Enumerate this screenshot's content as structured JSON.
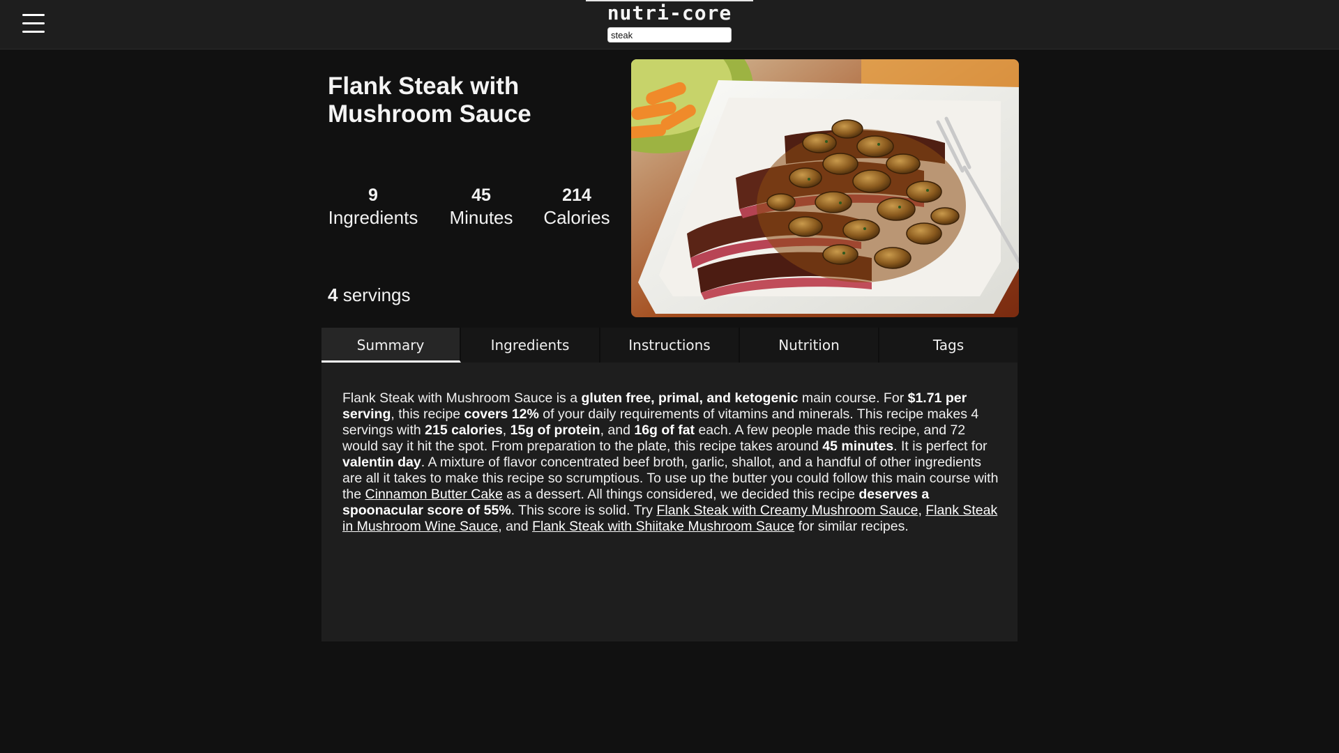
{
  "header": {
    "logo": "nutri-core",
    "search": {
      "value": "steak",
      "placeholder": ""
    }
  },
  "recipe": {
    "title": "Flank Steak with Mushroom Sauce",
    "stats": [
      {
        "value": "9",
        "label": "Ingredients"
      },
      {
        "value": "45",
        "label": "Minutes"
      },
      {
        "value": "214",
        "label": "Calories"
      }
    ],
    "servings": {
      "count": "4",
      "label": "servings"
    },
    "image_alt": "Flank Steak with Mushroom Sauce"
  },
  "tabs": [
    {
      "label": "Summary",
      "active": true
    },
    {
      "label": "Ingredients",
      "active": false
    },
    {
      "label": "Instructions",
      "active": false
    },
    {
      "label": "Nutrition",
      "active": false
    },
    {
      "label": "Tags",
      "active": false
    }
  ],
  "summary": {
    "parts": [
      {
        "t": "text",
        "v": "Flank Steak with Mushroom Sauce is a "
      },
      {
        "t": "bold",
        "v": "gluten free, primal, and ketogenic"
      },
      {
        "t": "text",
        "v": " main course. For "
      },
      {
        "t": "bold",
        "v": "$1.71 per serving"
      },
      {
        "t": "text",
        "v": ", this recipe "
      },
      {
        "t": "bold",
        "v": "covers 12%"
      },
      {
        "t": "text",
        "v": " of your daily requirements of vitamins and minerals. This recipe makes 4 servings with "
      },
      {
        "t": "bold",
        "v": "215 calories"
      },
      {
        "t": "text",
        "v": ", "
      },
      {
        "t": "bold",
        "v": "15g of protein"
      },
      {
        "t": "text",
        "v": ", and "
      },
      {
        "t": "bold",
        "v": "16g of fat"
      },
      {
        "t": "text",
        "v": " each. A few people made this recipe, and 72 would say it hit the spot. From preparation to the plate, this recipe takes around "
      },
      {
        "t": "bold",
        "v": "45 minutes"
      },
      {
        "t": "text",
        "v": ". It is perfect for "
      },
      {
        "t": "bold",
        "v": "valentin day"
      },
      {
        "t": "text",
        "v": ". A mixture of flavor concentrated beef broth, garlic, shallot, and a handful of other ingredients are all it takes to make this recipe so scrumptious. To use up the butter you could follow this main course with the "
      },
      {
        "t": "link",
        "v": "Cinnamon Butter Cake"
      },
      {
        "t": "text",
        "v": " as a dessert. All things considered, we decided this recipe "
      },
      {
        "t": "bold",
        "v": "deserves a spoonacular score of 55%"
      },
      {
        "t": "text",
        "v": ". This score is solid. Try "
      },
      {
        "t": "link",
        "v": "Flank Steak with Creamy Mushroom Sauce"
      },
      {
        "t": "text",
        "v": ", "
      },
      {
        "t": "link",
        "v": "Flank Steak in Mushroom Wine Sauce"
      },
      {
        "t": "text",
        "v": ", and "
      },
      {
        "t": "link",
        "v": "Flank Steak with Shiitake Mushroom Sauce"
      },
      {
        "t": "text",
        "v": " for similar recipes."
      }
    ]
  },
  "colors": {
    "background": "#111111",
    "header_bg": "#1e1e1e",
    "panel_bg": "#1e1e1e",
    "tab_active_indicator": "#ffffff"
  },
  "icons": {
    "menu": "hamburger-menu-icon"
  }
}
